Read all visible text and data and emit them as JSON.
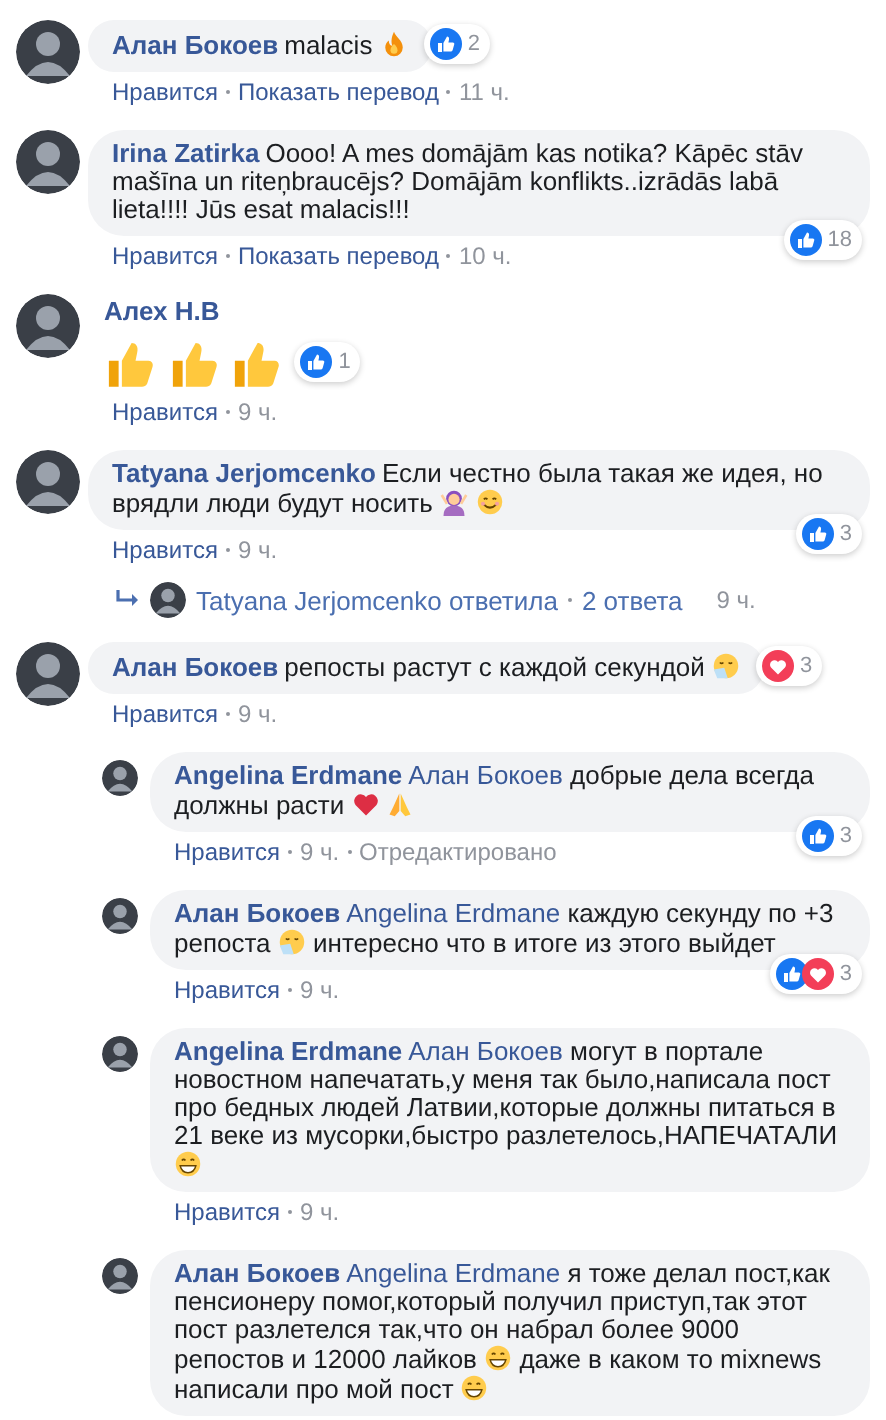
{
  "comments": [
    {
      "author": "Алан Бокоев",
      "body": [
        {
          "kind": "text",
          "text": "malacis"
        },
        {
          "kind": "fire"
        }
      ],
      "reactions": [
        {
          "kind": "like"
        }
      ],
      "reaction_count": "2",
      "actions": [
        {
          "kind": "link",
          "text": "Нравится"
        },
        {
          "kind": "link",
          "text": "Показать перевод"
        },
        {
          "kind": "time",
          "text": "11 ч."
        }
      ]
    },
    {
      "author": "Irina Zatirka",
      "body": [
        {
          "kind": "text",
          "text": "Oooo! A mes domājām kas notika? Kāpēc stāv mašīna un riteņbraucējs? Domājām konflikts..izrādās labā lieta!!!! Jūs esat malacis!!!"
        }
      ],
      "reactions": [
        {
          "kind": "like"
        }
      ],
      "reaction_count": "18",
      "actions": [
        {
          "kind": "link",
          "text": "Нравится"
        },
        {
          "kind": "link",
          "text": "Показать перевод"
        },
        {
          "kind": "time",
          "text": "10 ч."
        }
      ]
    },
    {
      "author": "Алех Н.В",
      "body": [
        {
          "kind": "thumbsup"
        },
        {
          "kind": "thumbsup"
        },
        {
          "kind": "thumbsup"
        }
      ],
      "reactions": [
        {
          "kind": "like"
        }
      ],
      "reaction_count": "1",
      "actions": [
        {
          "kind": "link",
          "text": "Нравится"
        },
        {
          "kind": "time",
          "text": "9 ч."
        }
      ]
    },
    {
      "author": "Tatyana Jerjomcenko",
      "body": [
        {
          "kind": "text",
          "text": "Если честно была такая же идея, но врядли люди будут носить"
        },
        {
          "kind": "gesturing"
        },
        {
          "kind": "smile"
        }
      ],
      "reactions": [
        {
          "kind": "like"
        }
      ],
      "reaction_count": "3",
      "actions": [
        {
          "kind": "link",
          "text": "Нравится"
        },
        {
          "kind": "time",
          "text": "9 ч."
        }
      ],
      "replies_link": {
        "text": "Tatyana Jerjomcenko ответила",
        "count": "2 ответа",
        "time": "9 ч."
      }
    },
    {
      "author": "Алан Бокоев",
      "body": [
        {
          "kind": "text",
          "text": "репосты растут с каждой секундой"
        },
        {
          "kind": "sneeze"
        }
      ],
      "reactions": [
        {
          "kind": "love"
        }
      ],
      "reaction_count": "3",
      "actions": [
        {
          "kind": "link",
          "text": "Нравится"
        },
        {
          "kind": "time",
          "text": "9 ч."
        }
      ],
      "replies": [
        {
          "author": "Angelina Erdmane",
          "body": [
            {
              "kind": "mention",
              "text": "Алан Бокоев"
            },
            {
              "kind": "text",
              "text": "добрые дела всегда должны расти"
            },
            {
              "kind": "heart"
            },
            {
              "kind": "pray"
            }
          ],
          "reactions": [
            {
              "kind": "like"
            }
          ],
          "reaction_count": "3",
          "actions": [
            {
              "kind": "link",
              "text": "Нравится"
            },
            {
              "kind": "time",
              "text": "9 ч."
            },
            {
              "kind": "time",
              "text": "Отредактировано"
            }
          ]
        },
        {
          "author": "Алан Бокоев",
          "body": [
            {
              "kind": "mention",
              "text": "Angelina Erdmane"
            },
            {
              "kind": "text",
              "text": "каждую секунду по +3 репоста"
            },
            {
              "kind": "sneeze"
            },
            {
              "kind": "text",
              "text": "интересно что в итоге из этого выйдет"
            }
          ],
          "reactions": [
            {
              "kind": "like"
            },
            {
              "kind": "love"
            }
          ],
          "reaction_count": "3",
          "actions": [
            {
              "kind": "link",
              "text": "Нравится"
            },
            {
              "kind": "time",
              "text": "9 ч."
            }
          ]
        },
        {
          "author": "Angelina Erdmane",
          "body": [
            {
              "kind": "mention",
              "text": "Алан Бокоев"
            },
            {
              "kind": "text",
              "text": "могут в портале новостном напечатать,у меня так было,написала пост про бедных людей Латвии,которые должны питаться в 21 веке из мусорки,быстро разлетелось,НАПЕЧАТАЛИ"
            },
            {
              "kind": "grin"
            }
          ],
          "actions": [
            {
              "kind": "link",
              "text": "Нравится"
            },
            {
              "kind": "time",
              "text": "9 ч."
            }
          ]
        },
        {
          "author": "Алан Бокоев",
          "body": [
            {
              "kind": "mention",
              "text": "Angelina Erdmane"
            },
            {
              "kind": "text",
              "text": "я тоже делал пост,как пенсионеру помог,который получил приступ,так этот пост разлетелся так,что он набрал более 9000 репостов и 12000 лайков"
            },
            {
              "kind": "grin"
            },
            {
              "kind": "text",
              "text": "даже в каком то mixnews написали про мой пост"
            },
            {
              "kind": "grin"
            }
          ]
        }
      ]
    }
  ]
}
